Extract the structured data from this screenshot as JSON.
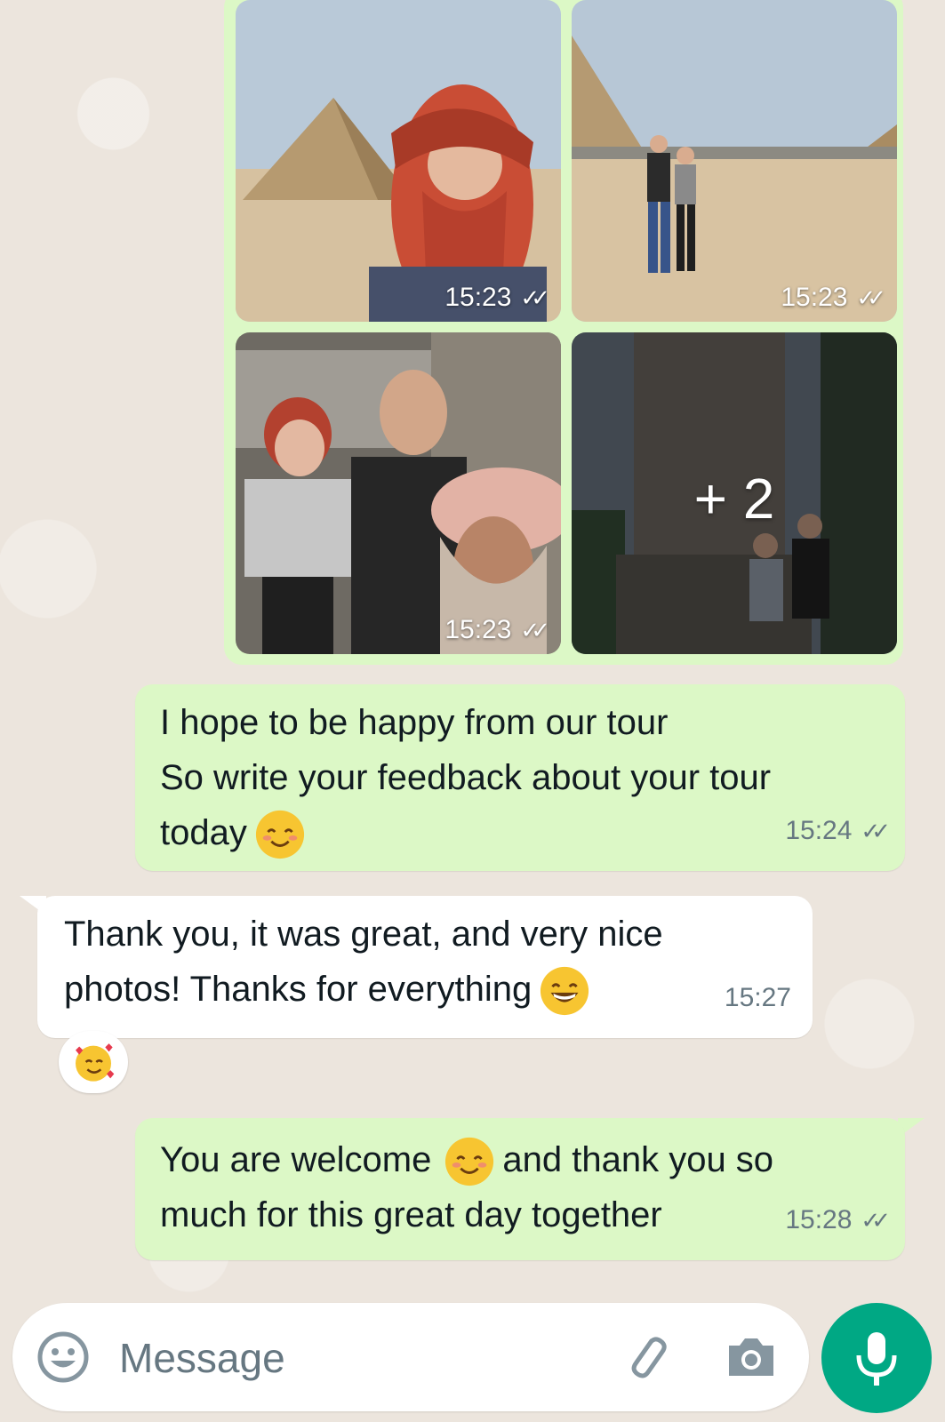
{
  "album": {
    "photos": [
      {
        "time": "15:23",
        "ticks": "✓✓"
      },
      {
        "time": "15:23",
        "ticks": "✓✓"
      },
      {
        "time": "15:23",
        "ticks": "✓✓"
      },
      {
        "more_label": "+ 2"
      }
    ]
  },
  "messages": [
    {
      "direction": "outgoing",
      "lines": [
        "I hope to be happy from our tour",
        "So write your feedback about your tour",
        "today"
      ],
      "emoji": "smiling-face-with-smiling-eyes",
      "time": "15:24",
      "ticks": "✓✓"
    },
    {
      "direction": "incoming",
      "lines": [
        "Thank you, it was great, and very nice",
        "photos! Thanks for everything"
      ],
      "emoji": "grinning-face",
      "time": "15:27",
      "reaction": "smiling-face-with-hearts"
    },
    {
      "direction": "outgoing",
      "lines": [
        "You are welcome",
        "and thank you so",
        "much for this great day together"
      ],
      "emoji": "smiling-face-with-smiling-eyes",
      "time": "15:28",
      "ticks": "✓✓"
    }
  ],
  "composer": {
    "placeholder": "Message",
    "icons": [
      "emoji-icon",
      "paperclip-icon",
      "camera-icon",
      "mic-icon"
    ]
  },
  "colors": {
    "outgoing_bubble": "#dcf8c6",
    "incoming_bubble": "#ffffff",
    "wallpaper": "#ece5dd",
    "accent": "#00a884",
    "ticks": "#667781"
  }
}
